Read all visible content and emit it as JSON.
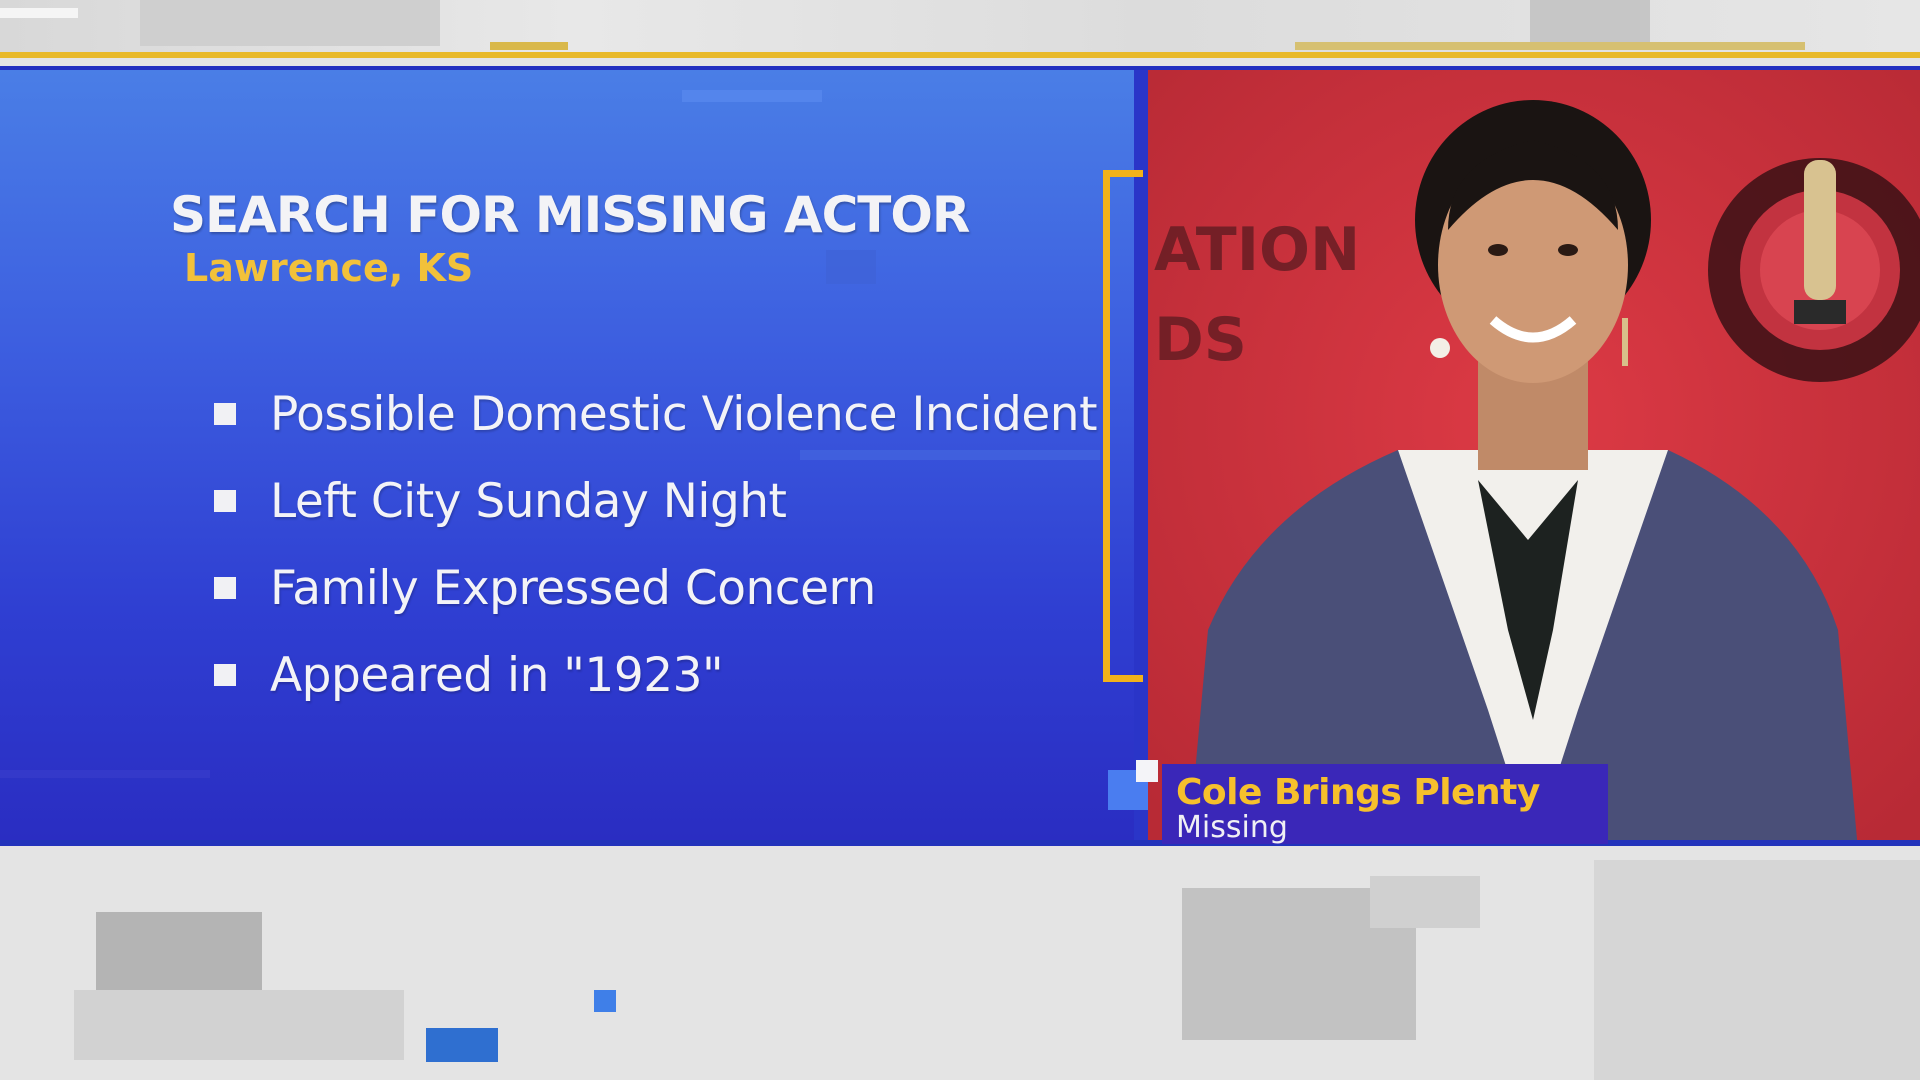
{
  "graphic": {
    "title": "SEARCH FOR MISSING ACTOR",
    "location": "Lawrence, KS",
    "bullets": [
      "Possible Domestic Violence Incident",
      "Left City Sunday Night",
      "Family Expressed Concern",
      "Appeared in  \"1923\""
    ]
  },
  "photo": {
    "backdrop_text": "ATION\nDS"
  },
  "lower_third": {
    "name": "Cole Brings Plenty",
    "status": "Missing"
  },
  "colors": {
    "panel_blue": "#3d5fe0",
    "accent_gold": "#f2b21a",
    "photo_red": "#d4343f",
    "lower_third_purple": "#3a27b8"
  }
}
